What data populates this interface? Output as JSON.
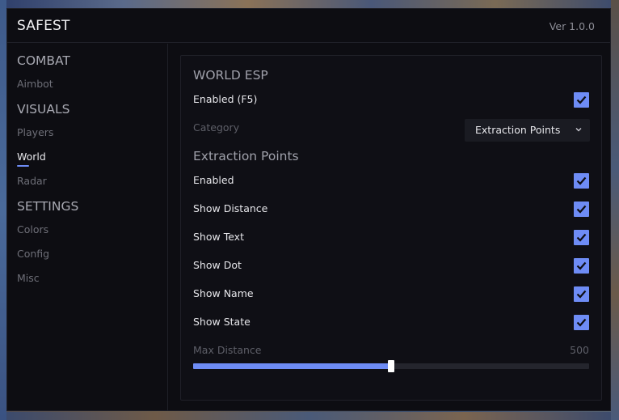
{
  "app": {
    "title": "SAFEST",
    "version": "Ver 1.0.0"
  },
  "sidebar": {
    "sections": [
      {
        "title": "COMBAT",
        "items": [
          {
            "label": "Aimbot"
          }
        ]
      },
      {
        "title": "VISUALS",
        "items": [
          {
            "label": "Players"
          },
          {
            "label": "World",
            "active": true
          },
          {
            "label": "Radar"
          }
        ]
      },
      {
        "title": "SETTINGS",
        "items": [
          {
            "label": "Colors"
          },
          {
            "label": "Config"
          },
          {
            "label": "Misc"
          }
        ]
      }
    ]
  },
  "panel": {
    "heading": "WORLD ESP",
    "enabled_label": "Enabled (F5)",
    "enabled_checked": true,
    "category_label": "Category",
    "category_value": "Extraction Points",
    "subheading": "Extraction Points",
    "options": [
      {
        "label": "Enabled",
        "checked": true
      },
      {
        "label": "Show Distance",
        "checked": true
      },
      {
        "label": "Show Text",
        "checked": true
      },
      {
        "label": "Show Dot",
        "checked": true
      },
      {
        "label": "Show Name",
        "checked": true
      },
      {
        "label": "Show State",
        "checked": true
      }
    ],
    "slider": {
      "label": "Max Distance",
      "value": "500",
      "fraction": 0.5
    }
  },
  "colors": {
    "accent": "#6e8cf5",
    "background": "#0d0d12",
    "panel": "#0f0f15"
  },
  "icons": {
    "checkbox_check": "check-icon",
    "select_chevron": "chevron-down-icon"
  }
}
